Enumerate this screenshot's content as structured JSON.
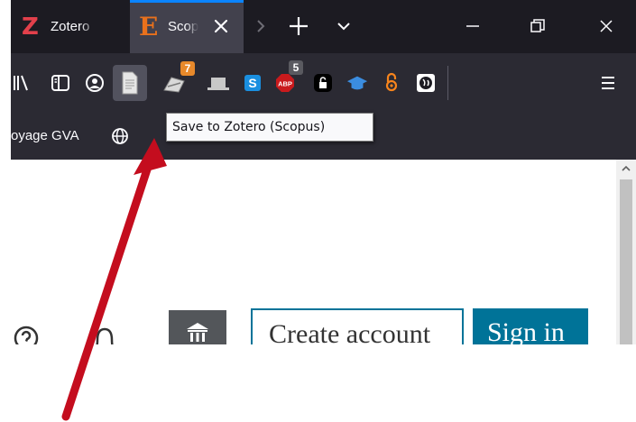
{
  "tabs": [
    {
      "label": "Zotero",
      "icon": "zotero-z-icon"
    },
    {
      "label": "Scopus",
      "icon": "elsevier-e-icon",
      "active": true
    }
  ],
  "toolbar": {
    "extensions": [
      {
        "name": "library-icon"
      },
      {
        "name": "sidebar-icon"
      },
      {
        "name": "account-icon"
      },
      {
        "name": "zotero-save-page-icon"
      },
      {
        "name": "extension-with-badge-icon",
        "badge": "7"
      },
      {
        "name": "laptop-icon"
      },
      {
        "name": "s-extension-icon"
      },
      {
        "name": "adblock-plus-icon",
        "badge": "5"
      },
      {
        "name": "lock-extension-icon"
      },
      {
        "name": "graduation-cap-icon"
      },
      {
        "name": "open-access-icon"
      },
      {
        "name": "globe-extension-icon"
      },
      {
        "name": "hamburger-menu-icon"
      }
    ],
    "badge_orange": "#e8892b",
    "badge_gray": "#5a5a60"
  },
  "bookmarks": {
    "label": "oyage GVA"
  },
  "tooltip": {
    "text": "Save to Zotero (Scopus)"
  },
  "content": {
    "create_account": "Create account",
    "sign_in": "Sign in"
  },
  "colors": {
    "tab_strip": "#1c1b22",
    "toolbar": "#2b2a33",
    "accent_blue": "#0a84ff",
    "scopus_teal": "#007398",
    "arrow_red": "#c40d1e"
  }
}
